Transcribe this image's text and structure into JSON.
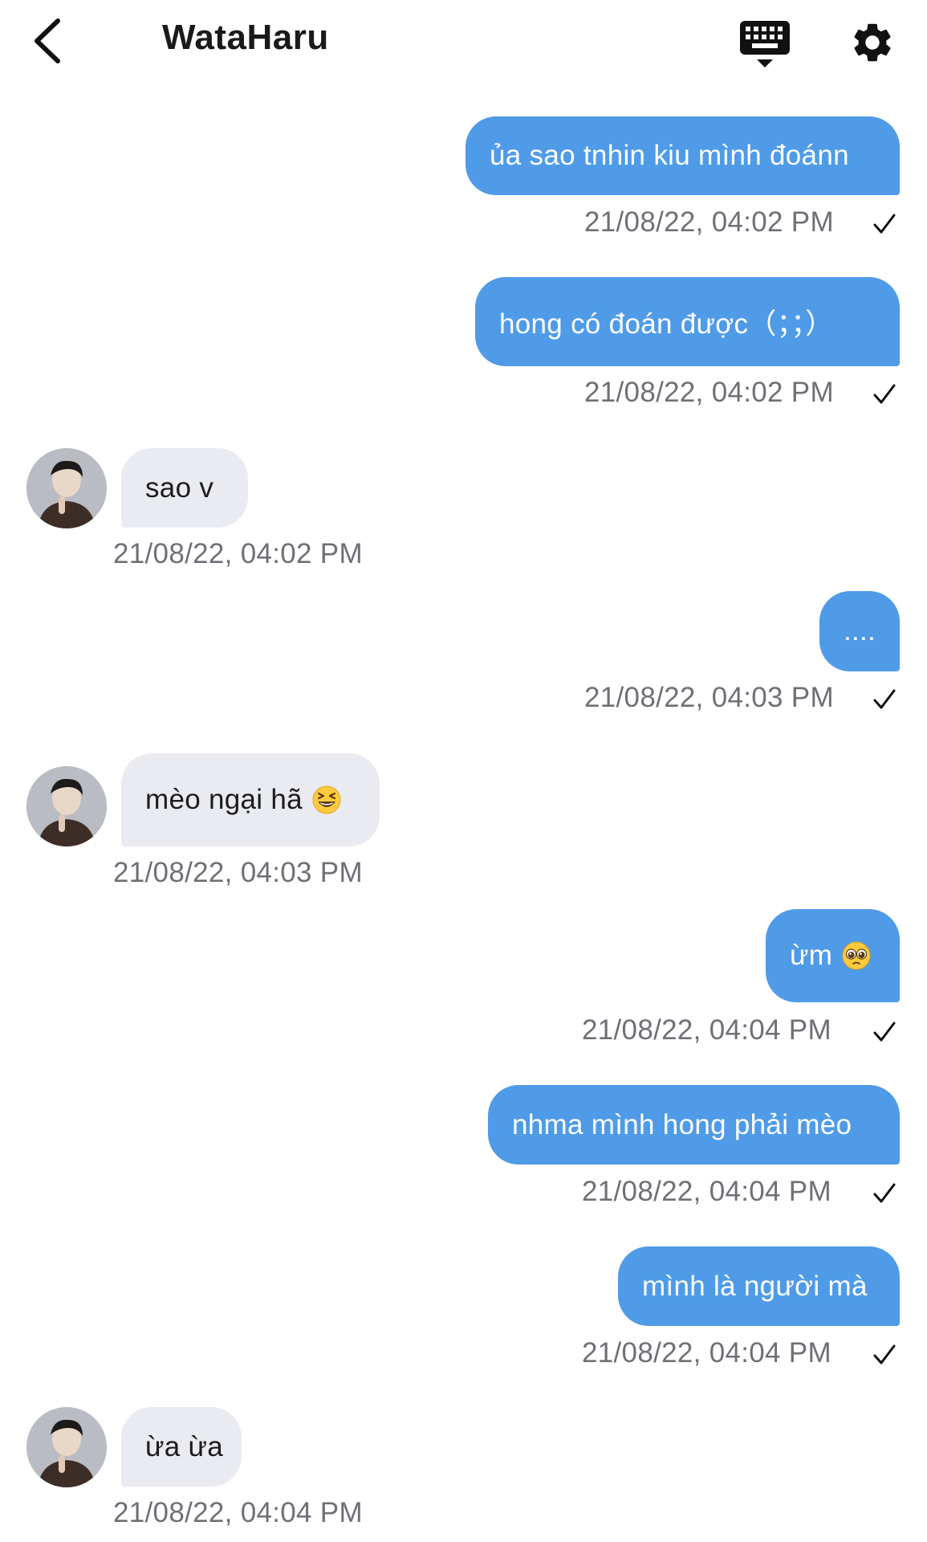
{
  "header": {
    "title": "WataHaru",
    "back_icon": "chevron-left-icon",
    "keyboard_icon": "keyboard-icon",
    "settings_icon": "gear-icon"
  },
  "colors": {
    "outgoing_bubble": "#4f9be8",
    "incoming_bubble": "#e9ebf0",
    "timestamp": "#6e7077"
  },
  "messages": [
    {
      "direction": "out",
      "text": "ủa sao tnhin kiu mình đoánn",
      "time": "21/08/22, 04:02 PM",
      "status_icon": "check-icon"
    },
    {
      "direction": "out",
      "text": "hong có đoán được（；；）",
      "time": "21/08/22, 04:02 PM",
      "status_icon": "check-icon"
    },
    {
      "direction": "in",
      "text": "sao v",
      "time": "21/08/22, 04:02 PM"
    },
    {
      "direction": "out",
      "text": "....",
      "time": "21/08/22, 04:03 PM",
      "status_icon": "check-icon"
    },
    {
      "direction": "in",
      "text": "mèo ngại hã",
      "emoji": "grinning-squinting-face-emoji",
      "time": "21/08/22, 04:03 PM"
    },
    {
      "direction": "out",
      "text": "ừm",
      "emoji": "pleading-face-emoji",
      "time": "21/08/22, 04:04 PM",
      "status_icon": "check-icon"
    },
    {
      "direction": "out",
      "text": "nhma mình hong phải mèo",
      "time": "21/08/22, 04:04 PM",
      "status_icon": "check-icon"
    },
    {
      "direction": "out",
      "text": "mình là người mà",
      "time": "21/08/22, 04:04 PM",
      "status_icon": "check-icon"
    },
    {
      "direction": "in",
      "text": "ừa ừa",
      "time": "21/08/22, 04:04 PM"
    }
  ]
}
